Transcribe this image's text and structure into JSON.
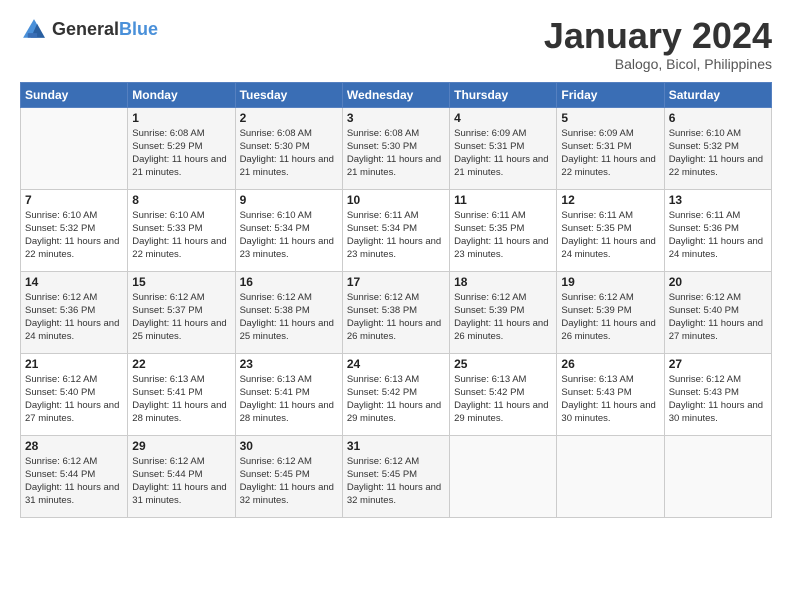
{
  "header": {
    "logo_general": "General",
    "logo_blue": "Blue",
    "month_title": "January 2024",
    "location": "Balogo, Bicol, Philippines"
  },
  "days_of_week": [
    "Sunday",
    "Monday",
    "Tuesday",
    "Wednesday",
    "Thursday",
    "Friday",
    "Saturday"
  ],
  "weeks": [
    [
      {
        "day": "",
        "sunrise": "",
        "sunset": "",
        "daylight": ""
      },
      {
        "day": "1",
        "sunrise": "Sunrise: 6:08 AM",
        "sunset": "Sunset: 5:29 PM",
        "daylight": "Daylight: 11 hours and 21 minutes."
      },
      {
        "day": "2",
        "sunrise": "Sunrise: 6:08 AM",
        "sunset": "Sunset: 5:30 PM",
        "daylight": "Daylight: 11 hours and 21 minutes."
      },
      {
        "day": "3",
        "sunrise": "Sunrise: 6:08 AM",
        "sunset": "Sunset: 5:30 PM",
        "daylight": "Daylight: 11 hours and 21 minutes."
      },
      {
        "day": "4",
        "sunrise": "Sunrise: 6:09 AM",
        "sunset": "Sunset: 5:31 PM",
        "daylight": "Daylight: 11 hours and 21 minutes."
      },
      {
        "day": "5",
        "sunrise": "Sunrise: 6:09 AM",
        "sunset": "Sunset: 5:31 PM",
        "daylight": "Daylight: 11 hours and 22 minutes."
      },
      {
        "day": "6",
        "sunrise": "Sunrise: 6:10 AM",
        "sunset": "Sunset: 5:32 PM",
        "daylight": "Daylight: 11 hours and 22 minutes."
      }
    ],
    [
      {
        "day": "7",
        "sunrise": "Sunrise: 6:10 AM",
        "sunset": "Sunset: 5:32 PM",
        "daylight": "Daylight: 11 hours and 22 minutes."
      },
      {
        "day": "8",
        "sunrise": "Sunrise: 6:10 AM",
        "sunset": "Sunset: 5:33 PM",
        "daylight": "Daylight: 11 hours and 22 minutes."
      },
      {
        "day": "9",
        "sunrise": "Sunrise: 6:10 AM",
        "sunset": "Sunset: 5:34 PM",
        "daylight": "Daylight: 11 hours and 23 minutes."
      },
      {
        "day": "10",
        "sunrise": "Sunrise: 6:11 AM",
        "sunset": "Sunset: 5:34 PM",
        "daylight": "Daylight: 11 hours and 23 minutes."
      },
      {
        "day": "11",
        "sunrise": "Sunrise: 6:11 AM",
        "sunset": "Sunset: 5:35 PM",
        "daylight": "Daylight: 11 hours and 23 minutes."
      },
      {
        "day": "12",
        "sunrise": "Sunrise: 6:11 AM",
        "sunset": "Sunset: 5:35 PM",
        "daylight": "Daylight: 11 hours and 24 minutes."
      },
      {
        "day": "13",
        "sunrise": "Sunrise: 6:11 AM",
        "sunset": "Sunset: 5:36 PM",
        "daylight": "Daylight: 11 hours and 24 minutes."
      }
    ],
    [
      {
        "day": "14",
        "sunrise": "Sunrise: 6:12 AM",
        "sunset": "Sunset: 5:36 PM",
        "daylight": "Daylight: 11 hours and 24 minutes."
      },
      {
        "day": "15",
        "sunrise": "Sunrise: 6:12 AM",
        "sunset": "Sunset: 5:37 PM",
        "daylight": "Daylight: 11 hours and 25 minutes."
      },
      {
        "day": "16",
        "sunrise": "Sunrise: 6:12 AM",
        "sunset": "Sunset: 5:38 PM",
        "daylight": "Daylight: 11 hours and 25 minutes."
      },
      {
        "day": "17",
        "sunrise": "Sunrise: 6:12 AM",
        "sunset": "Sunset: 5:38 PM",
        "daylight": "Daylight: 11 hours and 26 minutes."
      },
      {
        "day": "18",
        "sunrise": "Sunrise: 6:12 AM",
        "sunset": "Sunset: 5:39 PM",
        "daylight": "Daylight: 11 hours and 26 minutes."
      },
      {
        "day": "19",
        "sunrise": "Sunrise: 6:12 AM",
        "sunset": "Sunset: 5:39 PM",
        "daylight": "Daylight: 11 hours and 26 minutes."
      },
      {
        "day": "20",
        "sunrise": "Sunrise: 6:12 AM",
        "sunset": "Sunset: 5:40 PM",
        "daylight": "Daylight: 11 hours and 27 minutes."
      }
    ],
    [
      {
        "day": "21",
        "sunrise": "Sunrise: 6:12 AM",
        "sunset": "Sunset: 5:40 PM",
        "daylight": "Daylight: 11 hours and 27 minutes."
      },
      {
        "day": "22",
        "sunrise": "Sunrise: 6:13 AM",
        "sunset": "Sunset: 5:41 PM",
        "daylight": "Daylight: 11 hours and 28 minutes."
      },
      {
        "day": "23",
        "sunrise": "Sunrise: 6:13 AM",
        "sunset": "Sunset: 5:41 PM",
        "daylight": "Daylight: 11 hours and 28 minutes."
      },
      {
        "day": "24",
        "sunrise": "Sunrise: 6:13 AM",
        "sunset": "Sunset: 5:42 PM",
        "daylight": "Daylight: 11 hours and 29 minutes."
      },
      {
        "day": "25",
        "sunrise": "Sunrise: 6:13 AM",
        "sunset": "Sunset: 5:42 PM",
        "daylight": "Daylight: 11 hours and 29 minutes."
      },
      {
        "day": "26",
        "sunrise": "Sunrise: 6:13 AM",
        "sunset": "Sunset: 5:43 PM",
        "daylight": "Daylight: 11 hours and 30 minutes."
      },
      {
        "day": "27",
        "sunrise": "Sunrise: 6:12 AM",
        "sunset": "Sunset: 5:43 PM",
        "daylight": "Daylight: 11 hours and 30 minutes."
      }
    ],
    [
      {
        "day": "28",
        "sunrise": "Sunrise: 6:12 AM",
        "sunset": "Sunset: 5:44 PM",
        "daylight": "Daylight: 11 hours and 31 minutes."
      },
      {
        "day": "29",
        "sunrise": "Sunrise: 6:12 AM",
        "sunset": "Sunset: 5:44 PM",
        "daylight": "Daylight: 11 hours and 31 minutes."
      },
      {
        "day": "30",
        "sunrise": "Sunrise: 6:12 AM",
        "sunset": "Sunset: 5:45 PM",
        "daylight": "Daylight: 11 hours and 32 minutes."
      },
      {
        "day": "31",
        "sunrise": "Sunrise: 6:12 AM",
        "sunset": "Sunset: 5:45 PM",
        "daylight": "Daylight: 11 hours and 32 minutes."
      },
      {
        "day": "",
        "sunrise": "",
        "sunset": "",
        "daylight": ""
      },
      {
        "day": "",
        "sunrise": "",
        "sunset": "",
        "daylight": ""
      },
      {
        "day": "",
        "sunrise": "",
        "sunset": "",
        "daylight": ""
      }
    ]
  ]
}
